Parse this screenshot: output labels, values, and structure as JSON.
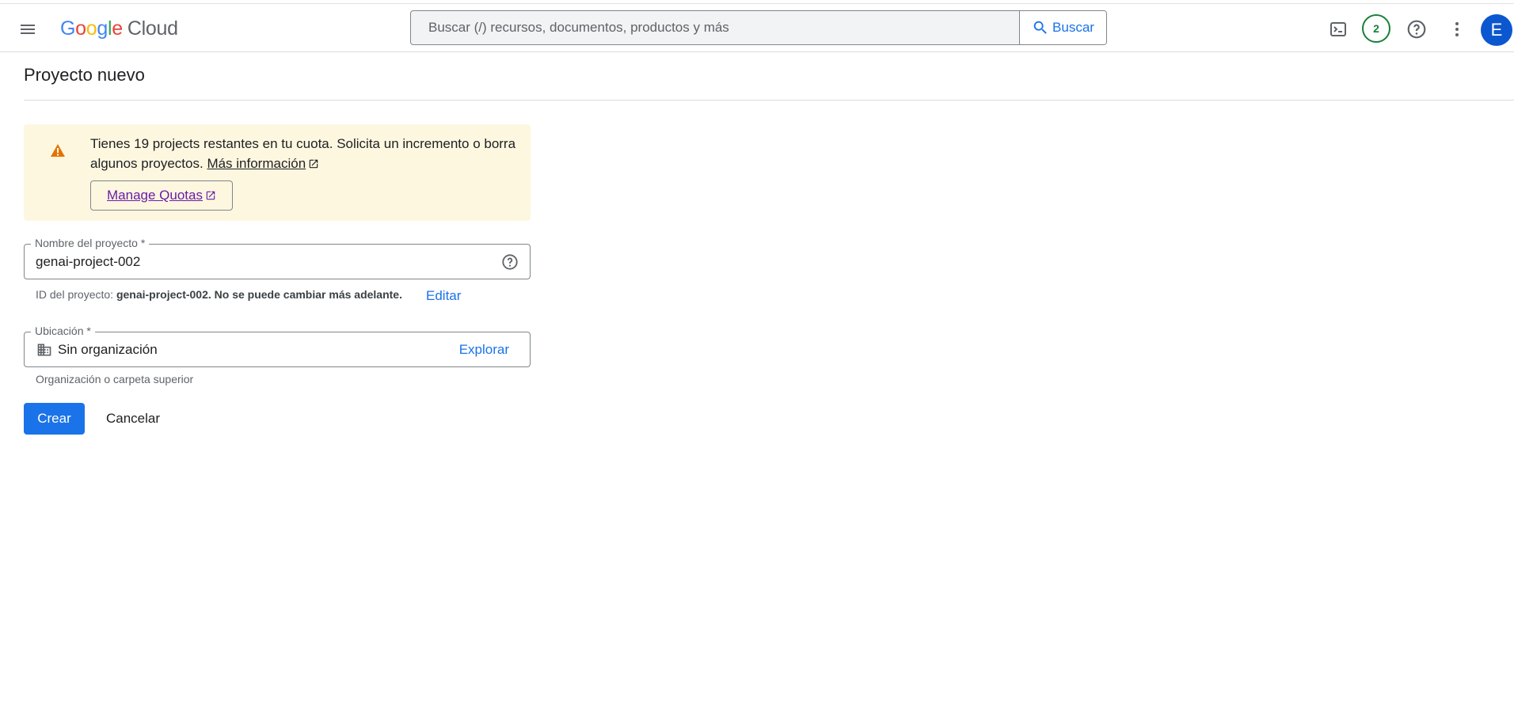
{
  "header": {
    "logo": {
      "google_letters": [
        "G",
        "o",
        "o",
        "g",
        "l",
        "e"
      ],
      "google_colors": [
        "#4285f4",
        "#ea4335",
        "#fbbc05",
        "#4285f4",
        "#34a853",
        "#ea4335"
      ],
      "product": "Cloud"
    },
    "search": {
      "placeholder": "Buscar (/) recursos, documentos, productos y más",
      "button_label": "Buscar"
    },
    "notifications_count": "2",
    "avatar_initial": "E",
    "icons": [
      "menu-icon",
      "search-icon",
      "cloud-shell-icon",
      "help-icon",
      "more-vert-icon"
    ]
  },
  "page": {
    "title": "Proyecto nuevo"
  },
  "quota_warning": {
    "icon": "warning-icon",
    "text": "Tienes 19 projects restantes en tu cuota. Solicita un incremento o borra algunos proyectos.",
    "learn_more": "Más información",
    "manage_button": "Manage Quotas"
  },
  "project_name": {
    "label": "Nombre del proyecto *",
    "value": "genai-project-002",
    "id_hint_prefix": "ID del proyecto:",
    "id_hint_bold": "genai-project-002. No se puede cambiar más adelante.",
    "edit_label": "Editar"
  },
  "location": {
    "label": "Ubicación *",
    "value": "Sin organización",
    "browse_label": "Explorar",
    "hint": "Organización o carpeta superior"
  },
  "actions": {
    "create_label": "Crear",
    "cancel_label": "Cancelar"
  },
  "colors": {
    "primary": "#1a73e8",
    "warning_bg": "#fef7e0",
    "warning_icon": "#e37400",
    "notif_green": "#188038"
  }
}
